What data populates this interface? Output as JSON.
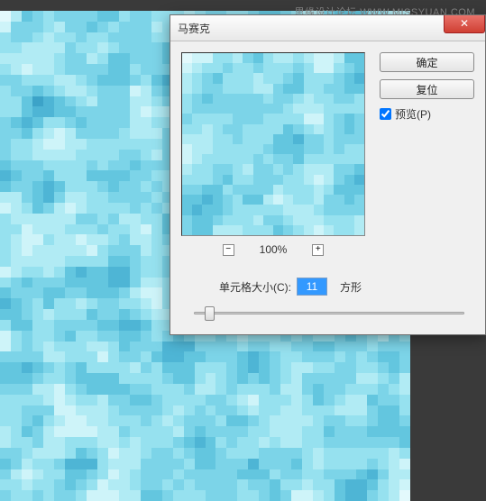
{
  "watermark": "思缘设计论坛  WWW.MISSYUAN.COM",
  "dialog": {
    "title": "马赛克",
    "ok_label": "确定",
    "reset_label": "复位",
    "preview_label": "预览(P)",
    "preview_checked": true,
    "zoom": {
      "minus_label": "−",
      "plus_label": "+",
      "percent": "100%"
    },
    "cell_size": {
      "label": "单元格大小(C):",
      "value": "11",
      "unit": "方形"
    },
    "close_label": "✕"
  },
  "colors": {
    "mosaic_palette": [
      "#2a8fb8",
      "#3ca3c8",
      "#4eb5d5",
      "#63c6df",
      "#7cd4e8",
      "#96e1ef",
      "#b1ebf4",
      "#cef4f9",
      "#e3f9fc"
    ]
  }
}
